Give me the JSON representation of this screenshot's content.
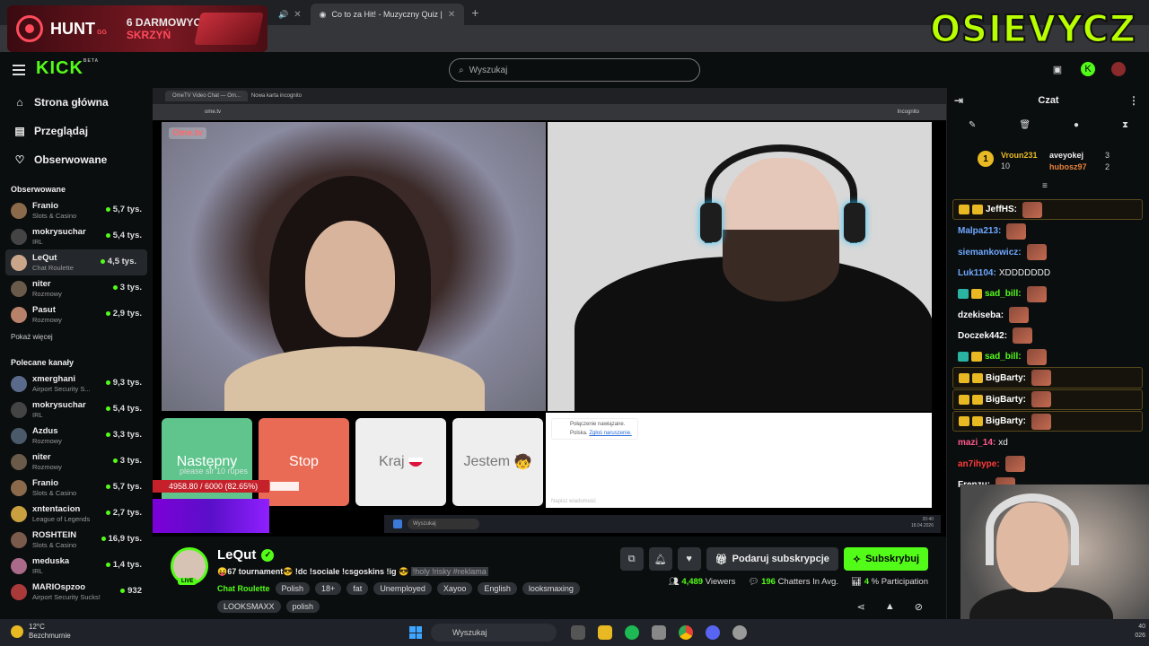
{
  "browser": {
    "tabs": [
      {
        "label": "Co to za Hit! - Muzyczny Quiz |"
      }
    ]
  },
  "hunt": {
    "name": "HUNT",
    "suffix": "GG",
    "promo_line1": "6 DARMOWYCH",
    "promo_line2": "SKRZYŃ"
  },
  "overlay_brand": "OSIEVYCZ",
  "header": {
    "logo": "KICK",
    "logo_beta": "BETA",
    "search_placeholder": "Wyszukaj"
  },
  "sidebar": {
    "nav": [
      {
        "label": "Strona główna",
        "icon": "home-icon"
      },
      {
        "label": "Przeglądaj",
        "icon": "browse-icon"
      },
      {
        "label": "Obserwowane",
        "icon": "heart-icon"
      }
    ],
    "followed_heading": "Obserwowane",
    "followed": [
      {
        "name": "Franio",
        "category": "Slots & Casino",
        "viewers": "5,7 tys."
      },
      {
        "name": "mokrysuchar",
        "category": "IRL",
        "viewers": "5,4 tys."
      },
      {
        "name": "LeQut",
        "category": "Chat Roulette",
        "viewers": "4,5 tys."
      },
      {
        "name": "niter",
        "category": "Rozmowy",
        "viewers": "3 tys."
      },
      {
        "name": "Pasut",
        "category": "Rozmowy",
        "viewers": "2,9 tys."
      }
    ],
    "show_more": "Pokaż więcej",
    "recommended_heading": "Polecane kanały",
    "recommended": [
      {
        "name": "xmerghani",
        "category": "Airport Security S...",
        "viewers": "9,3 tys."
      },
      {
        "name": "mokrysuchar",
        "category": "IRL",
        "viewers": "5,4 tys."
      },
      {
        "name": "Azdus",
        "category": "Rozmowy",
        "viewers": "3,3 tys."
      },
      {
        "name": "niter",
        "category": "Rozmowy",
        "viewers": "3 tys."
      },
      {
        "name": "Franio",
        "category": "Slots & Casino",
        "viewers": "5,7 tys."
      },
      {
        "name": "xntentacion",
        "category": "League of Legends",
        "viewers": "2,7 tys."
      },
      {
        "name": "ROSHTEIN",
        "category": "Slots & Casino",
        "viewers": "16,9 tys."
      },
      {
        "name": "meduska",
        "category": "IRL",
        "viewers": "1,4 tys."
      },
      {
        "name": "MARIOspzoo",
        "category": "Airport Security Sucks!",
        "viewers": "932"
      }
    ]
  },
  "stream": {
    "inner_tabs": [
      "OmeTV Video Chat — Om...",
      "Nowa karta incognito"
    ],
    "inner_url": "ome.tv",
    "incognito": "Incognito",
    "ome_logo": "Ome.tv",
    "buttons": [
      "Następny",
      "Stop",
      "Kraj",
      "Jestem"
    ],
    "chat_msg": "Połączenie nawiązane.",
    "chat_msg2": "Polska.",
    "chat_link": "Zgłoś naruszenie.",
    "chat_placeholder": "Napisz wiadomość",
    "overlay_text": "please sir 10 rupes",
    "progress_text": "4958.80 / 6000 (82.65%)",
    "progress_value": 0.8265,
    "inner_search": "Wyszukaj",
    "inner_time": "20:40",
    "inner_date": "18.04.2026"
  },
  "info": {
    "streamer": "LeQut",
    "live": "LIVE",
    "title": "😝67 tournament😎 !dc !sociale !csgoskins !ig 😎",
    "title_tags": "!holy !risky #reklama",
    "category": "Chat Roulette",
    "tags": [
      "Polish",
      "18+",
      "fat",
      "Unemployed",
      "Xayoo",
      "English",
      "looksmaxing"
    ],
    "tags2": [
      "LOOKSMAXX",
      "polish"
    ],
    "gift_label": "Podaruj subskrypcje",
    "sub_label": "Subskrybuj",
    "viewers": "4,489",
    "viewers_label": "Viewers",
    "chatters": "196",
    "chatters_label": "Chatters In Avg.",
    "participation": "4",
    "participation_label": "% Participation"
  },
  "chat": {
    "title": "Czat",
    "leader": {
      "first": "Vroun231",
      "first_count": "10",
      "second": "aveyokej",
      "second_count": "3",
      "third": "hubosz97",
      "third_count": "2",
      "rank": "1"
    },
    "messages": [
      {
        "user": "JeffHS:",
        "text": "",
        "color": "#ffffff",
        "gold": true,
        "badges": 2
      },
      {
        "user": "Malpa213:",
        "text": "",
        "color": "#6ea8ff",
        "gold": false,
        "badges": 0
      },
      {
        "user": "siemankowicz:",
        "text": "",
        "color": "#6ea8ff",
        "gold": false,
        "badges": 0
      },
      {
        "user": "Luk1104:",
        "text": "XDDDDDDD",
        "color": "#6ea8ff",
        "gold": false,
        "badges": 0
      },
      {
        "user": "sad_bill:",
        "text": "",
        "color": "#53fc18",
        "gold": false,
        "badges": 2
      },
      {
        "user": "dzekiseba:",
        "text": "",
        "color": "#ffffff",
        "gold": false,
        "badges": 0
      },
      {
        "user": "Doczek442:",
        "text": "",
        "color": "#ffffff",
        "gold": false,
        "badges": 0
      },
      {
        "user": "sad_bill:",
        "text": "",
        "color": "#53fc18",
        "gold": false,
        "badges": 2
      },
      {
        "user": "BigBarty:",
        "text": "",
        "color": "#ffffff",
        "gold": true,
        "badges": 2
      },
      {
        "user": "BigBarty:",
        "text": "",
        "color": "#ffffff",
        "gold": true,
        "badges": 2
      },
      {
        "user": "BigBarty:",
        "text": "",
        "color": "#ffffff",
        "gold": true,
        "badges": 2
      },
      {
        "user": "mazi_14:",
        "text": "xd",
        "color": "#ff5a8a",
        "gold": false,
        "badges": 0
      },
      {
        "user": "an7ihype:",
        "text": "",
        "color": "#ff3a3a",
        "gold": false,
        "badges": 0
      },
      {
        "user": "Frenzu:",
        "text": "",
        "color": "#ffffff",
        "gold": false,
        "badges": 0
      }
    ]
  },
  "taskbar": {
    "weather_temp": "12°C",
    "weather_desc": "Bezchmurnie",
    "search": "Wyszukaj",
    "time": "40",
    "date": "026"
  }
}
